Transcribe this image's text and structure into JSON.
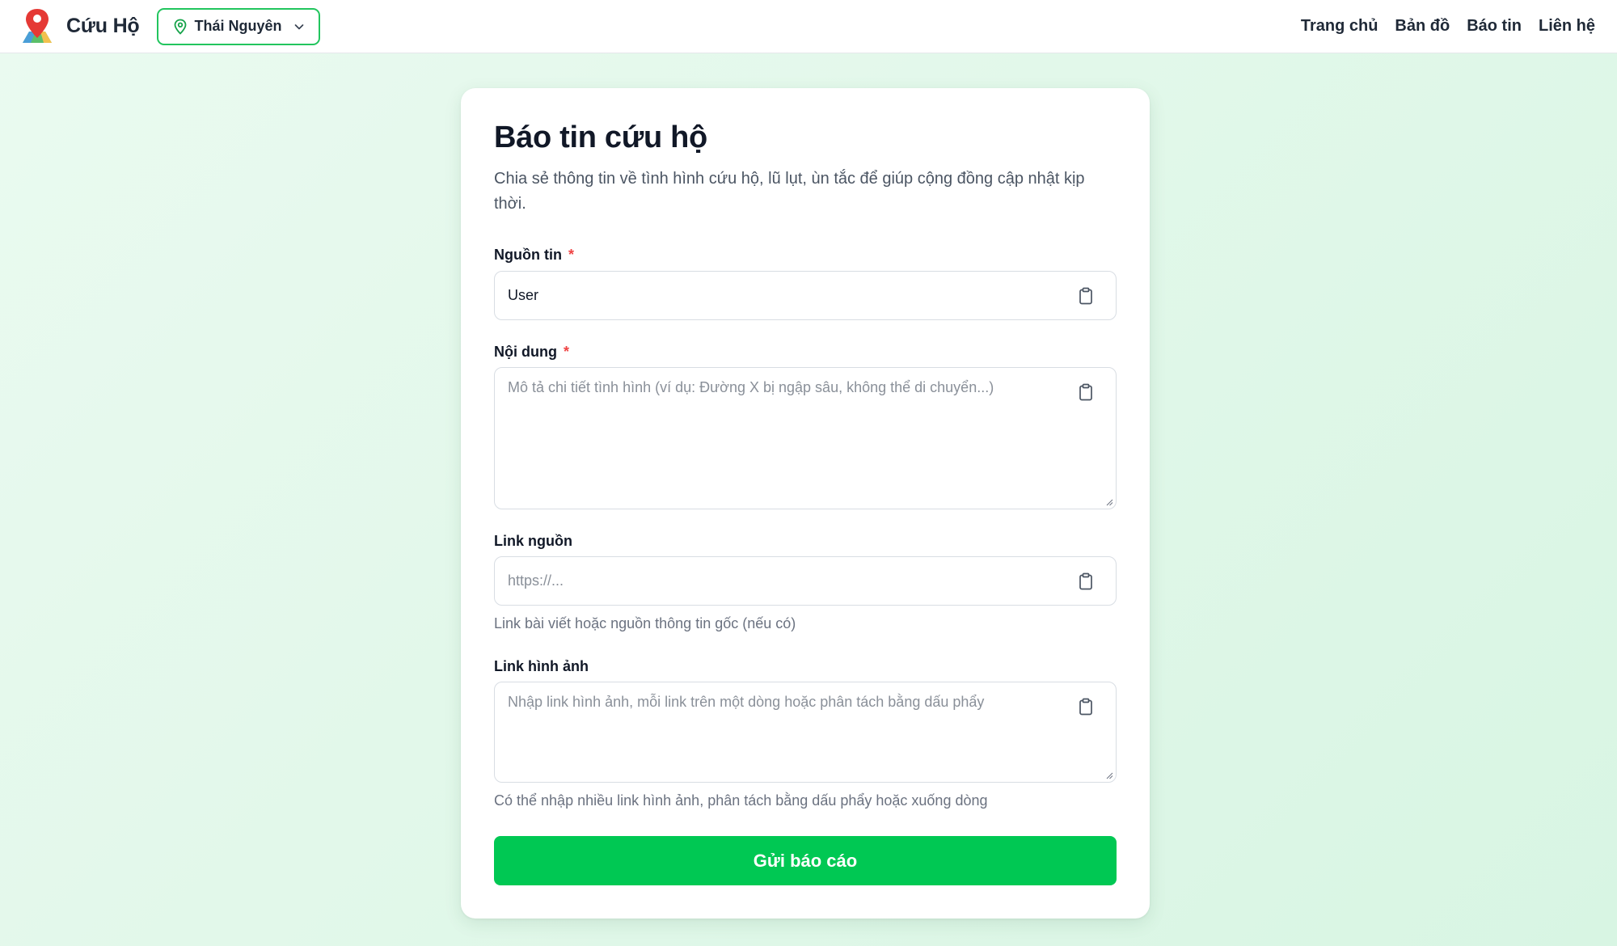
{
  "header": {
    "brand": "Cứu Hộ",
    "location": "Thái Nguyên",
    "nav": [
      "Trang chủ",
      "Bản đồ",
      "Báo tin",
      "Liên hệ"
    ]
  },
  "form": {
    "title": "Báo tin cứu hộ",
    "subtitle": "Chia sẻ thông tin về tình hình cứu hộ, lũ lụt, ùn tắc để giúp cộng đồng cập nhật kịp thời.",
    "required_mark": "*",
    "source": {
      "label": "Nguồn tin",
      "value": "User"
    },
    "content": {
      "label": "Nội dung",
      "placeholder": "Mô tả chi tiết tình hình (ví dụ: Đường X bị ngập sâu, không thể di chuyển...)"
    },
    "link": {
      "label": "Link nguồn",
      "placeholder": "https://...",
      "help": "Link bài viết hoặc nguồn thông tin gốc (nếu có)"
    },
    "images": {
      "label": "Link hình ảnh",
      "placeholder": "Nhập link hình ảnh, mỗi link trên một dòng hoặc phân tách bằng dấu phẩy",
      "help": "Có thể nhập nhiều link hình ảnh, phân tách bằng dấu phẩy hoặc xuống dòng"
    },
    "submit": "Gửi báo cáo"
  },
  "colors": {
    "accent": "#00c853",
    "accent_border": "#22c55e",
    "required": "#ef4444",
    "background": "#e2f8ea"
  },
  "icons": {
    "logo": "map-pin-logo",
    "location": "location-pin-icon",
    "dropdown": "chevron-down-icon",
    "paste": "clipboard-icon"
  }
}
